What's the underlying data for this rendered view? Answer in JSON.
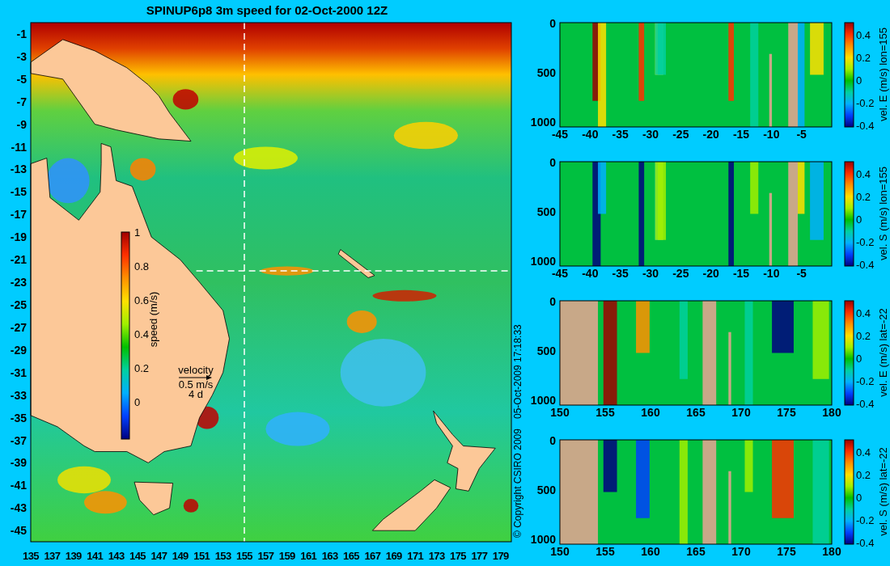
{
  "title": "SPINUP6p8 3m speed for 02-Oct-2000 12Z",
  "map": {
    "y_ticks": [
      "-1",
      "-3",
      "-5",
      "-7",
      "-9",
      "-11",
      "-13",
      "-15",
      "-17",
      "-19",
      "-21",
      "-23",
      "-25",
      "-27",
      "-29",
      "-31",
      "-33",
      "-35",
      "-37",
      "-39",
      "-41",
      "-43",
      "-45"
    ],
    "x_ticks": [
      "135",
      "137",
      "139",
      "141",
      "143",
      "145",
      "147",
      "149",
      "151",
      "153",
      "155",
      "157",
      "159",
      "161",
      "163",
      "165",
      "167",
      "169",
      "171",
      "173",
      "175",
      "177",
      "179"
    ],
    "colorbar": {
      "label": "speed (m/s)",
      "ticks": [
        "1",
        "0.8",
        "0.6",
        "0.4",
        "0.2",
        "0"
      ]
    },
    "legend": {
      "title": "velocity",
      "speed": "0.5 m/s",
      "duration": "4 d"
    }
  },
  "credits": {
    "copyright": "© Copyright CSIRO 2009",
    "timestamp": "05-Oct-2009 17:18:33"
  },
  "sections": [
    {
      "kind": "lat",
      "label": "vel. E (m/s) lon=155",
      "y_ticks": [
        "0",
        "500",
        "1000"
      ],
      "x_ticks": [
        "-45",
        "-40",
        "-35",
        "-30",
        "-25",
        "-20",
        "-15",
        "-10",
        "-5"
      ],
      "colorbar_ticks": [
        "0.4",
        "0.2",
        "0",
        "-0.2",
        "-0.4"
      ]
    },
    {
      "kind": "lat",
      "label": "vel. S (m/s) lon=155",
      "y_ticks": [
        "0",
        "500",
        "1000"
      ],
      "x_ticks": [
        "-45",
        "-40",
        "-35",
        "-30",
        "-25",
        "-20",
        "-15",
        "-10",
        "-5"
      ],
      "colorbar_ticks": [
        "0.4",
        "0.2",
        "0",
        "-0.2",
        "-0.4"
      ]
    },
    {
      "kind": "lon",
      "label": "vel. E (m/s) lat=-22",
      "y_ticks": [
        "0",
        "500",
        "1000"
      ],
      "x_ticks": [
        "150",
        "155",
        "160",
        "165",
        "170",
        "175",
        "180"
      ],
      "colorbar_ticks": [
        "0.4",
        "0.2",
        "0",
        "-0.2",
        "-0.4"
      ]
    },
    {
      "kind": "lon",
      "label": "vel. S (m/s) lat=-22",
      "y_ticks": [
        "0",
        "500",
        "1000"
      ],
      "x_ticks": [
        "150",
        "155",
        "160",
        "165",
        "170",
        "175",
        "180"
      ],
      "colorbar_ticks": [
        "0.4",
        "0.2",
        "0",
        "-0.2",
        "-0.4"
      ]
    }
  ]
}
